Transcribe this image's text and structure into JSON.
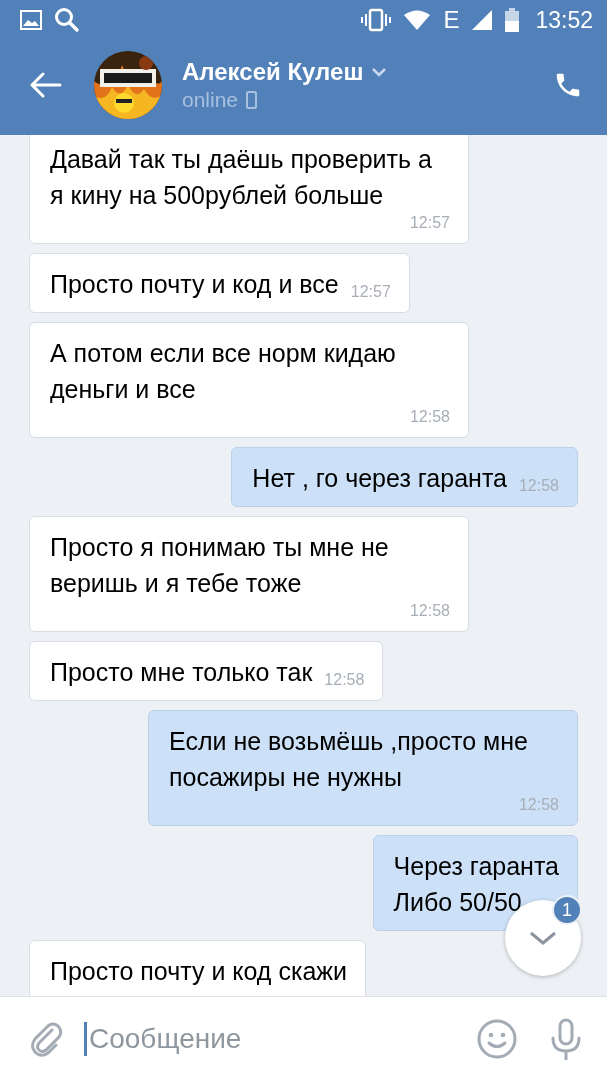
{
  "status_bar": {
    "network": "E",
    "time": "13:52"
  },
  "header": {
    "name": "Алексей Кулеш",
    "presence": "online"
  },
  "messages": [
    {
      "kind": "incoming",
      "text": "Давай так ты даёшь проверить а я кину на 500рублей больше",
      "time": "12:57"
    },
    {
      "kind": "incoming",
      "text": "Просто почту и код и все",
      "time": "12:57"
    },
    {
      "kind": "incoming",
      "text": "А потом если все норм кидаю деньги и все",
      "time": "12:58"
    },
    {
      "kind": "outgoing",
      "text": "Нет , го через гаранта",
      "time": "12:58"
    },
    {
      "kind": "incoming",
      "text": "Просто я понимаю ты мне не веришь и я тебе тоже",
      "time": "12:58"
    },
    {
      "kind": "incoming",
      "text": "Просто мне только так",
      "time": "12:58"
    },
    {
      "kind": "outgoing",
      "text": "Если не возьмёшь ,просто мне посажиры не нужны",
      "time": "12:58"
    },
    {
      "kind": "outgoing",
      "text": "Через гаранта\nЛибо 50/50"
    },
    {
      "kind": "incoming",
      "text": "Просто почту  и код скажи"
    }
  ],
  "scroll_down": {
    "badge": "1"
  },
  "composer": {
    "placeholder": "Сообщение"
  }
}
